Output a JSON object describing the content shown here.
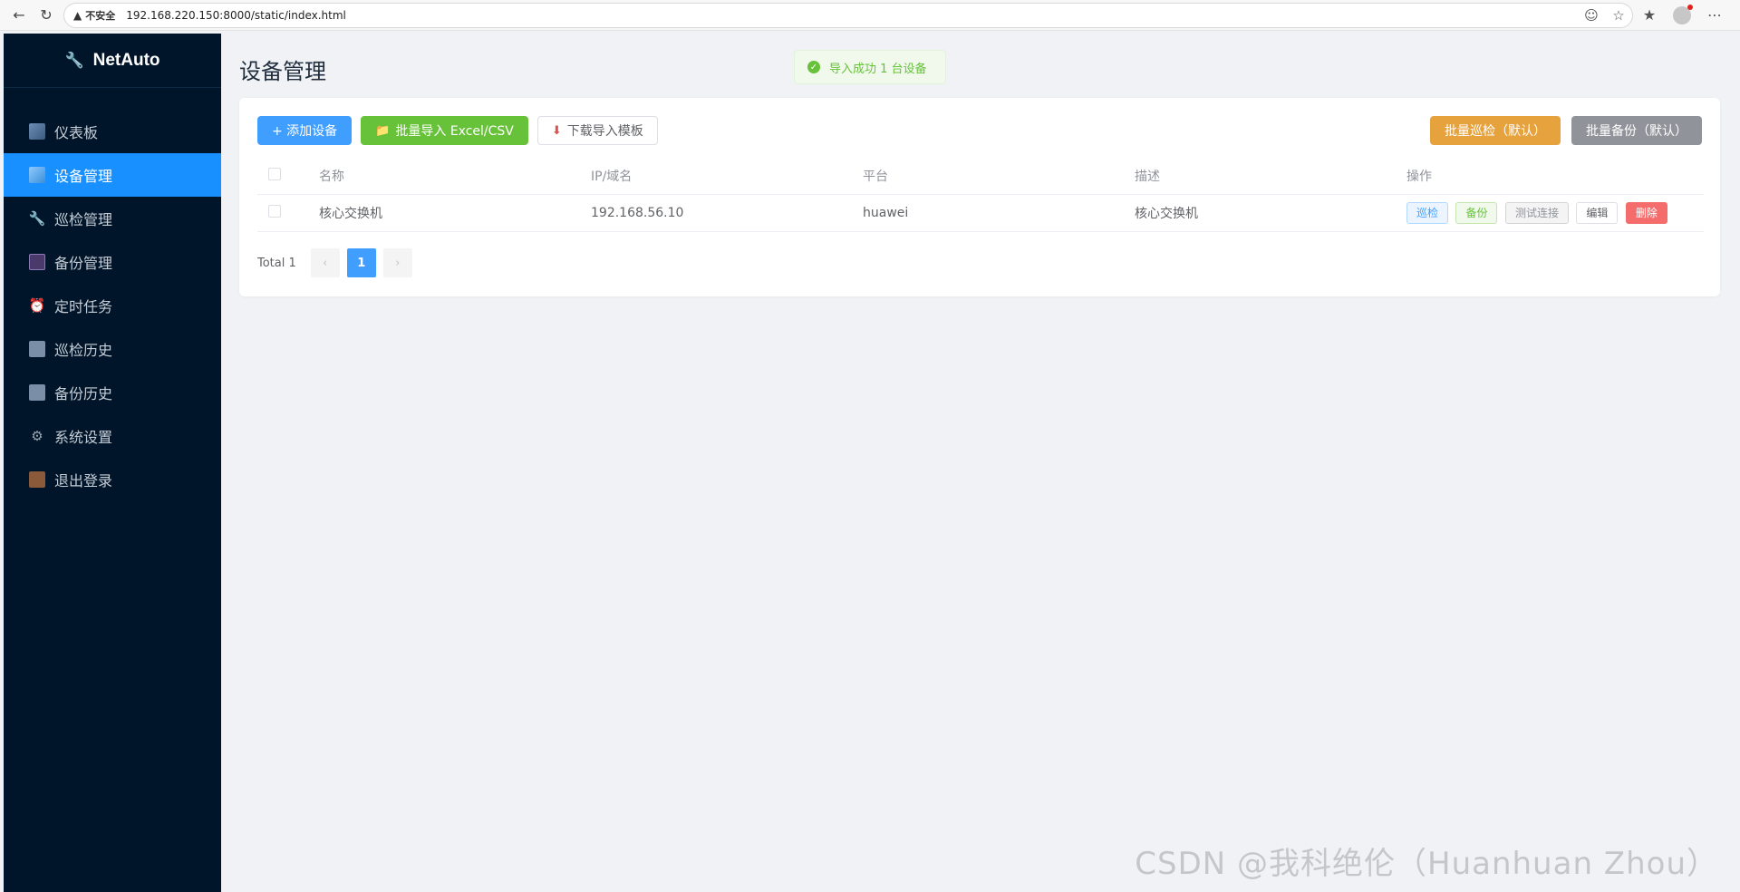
{
  "browser": {
    "insecure_label": "不安全",
    "url": "192.168.220.150:8000/static/index.html"
  },
  "sidebar": {
    "brand": "NetAuto",
    "items": [
      {
        "label": "仪表板",
        "icon": "dashboard-icon"
      },
      {
        "label": "设备管理",
        "icon": "device-icon",
        "active": true
      },
      {
        "label": "巡检管理",
        "icon": "wrench-icon"
      },
      {
        "label": "备份管理",
        "icon": "floppy-disk-icon"
      },
      {
        "label": "定时任务",
        "icon": "alarm-clock-icon"
      },
      {
        "label": "巡检历史",
        "icon": "notebook-icon"
      },
      {
        "label": "备份历史",
        "icon": "document-icon"
      },
      {
        "label": "系统设置",
        "icon": "gear-icon"
      },
      {
        "label": "退出登录",
        "icon": "door-icon"
      }
    ]
  },
  "main": {
    "title": "设备管理",
    "toast": "导入成功 1 台设备",
    "toolbar": {
      "add": "+ 添加设备",
      "import": "批量导入 Excel/CSV",
      "download": "下载导入模板",
      "batch_patrol": "批量巡检（默认）",
      "batch_backup": "批量备份（默认）"
    },
    "table": {
      "headers": [
        "名称",
        "IP/域名",
        "平台",
        "描述",
        "操作"
      ],
      "rows": [
        {
          "name": "核心交换机",
          "ip": "192.168.56.10",
          "platform": "huawei",
          "desc": "核心交换机"
        }
      ],
      "actions": {
        "patrol": "巡检",
        "backup": "备份",
        "test": "测试连接",
        "edit": "编辑",
        "delete": "删除"
      }
    },
    "pager": {
      "total": "Total 1",
      "current": "1"
    }
  },
  "watermark": "CSDN @我科绝伦（Huanhuan Zhou）",
  "colors": {
    "sidebar_bg": "#001529",
    "active": "#1890ff",
    "primary": "#409eff",
    "success": "#67c23a",
    "warning": "#e6a23c",
    "info": "#909399",
    "danger": "#f56c6c"
  }
}
